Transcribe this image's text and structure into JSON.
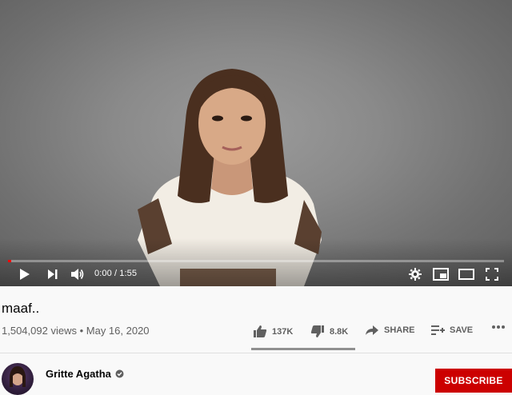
{
  "video": {
    "time_display": "0:00 / 1:55",
    "progress_fraction": 0.0
  },
  "info": {
    "title": "maaf..",
    "views": "1,504,092 views",
    "separator": "•",
    "date": "May 16, 2020"
  },
  "actions": {
    "like_count": "137K",
    "dislike_count": "8.8K",
    "share_label": "SHARE",
    "save_label": "SAVE"
  },
  "channel": {
    "name": "Gritte Agatha",
    "verified": true
  },
  "subscribe_label": "SUBSCRIBE",
  "colors": {
    "accent_red": "#cc0000",
    "progress_red": "#ff0000",
    "text_secondary": "#606060"
  },
  "icons": [
    "play-icon",
    "next-icon",
    "volume-icon",
    "settings-icon",
    "miniplayer-icon",
    "theater-icon",
    "fullscreen-icon",
    "like-icon",
    "dislike-icon",
    "share-icon",
    "save-playlist-icon",
    "more-icon",
    "verified-icon"
  ]
}
